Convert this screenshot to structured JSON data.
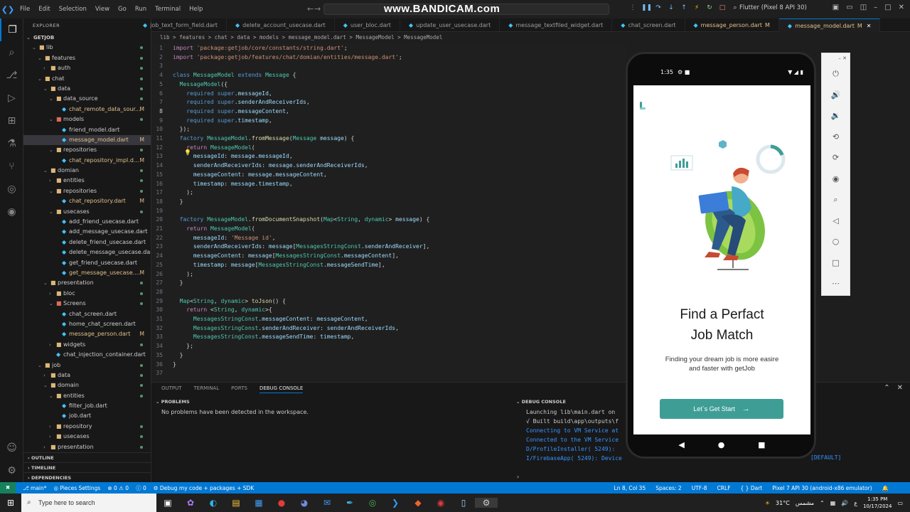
{
  "titlebar": {
    "menu": [
      "File",
      "Edit",
      "Selection",
      "View",
      "Go",
      "Run",
      "Terminal",
      "Help"
    ],
    "watermark": "www.BANDICAM.com",
    "device": "Flutter (Pixel 8 API 30)"
  },
  "sidebar": {
    "header": "EXPLORER",
    "root": "GETJOB",
    "tree": [
      {
        "label": "lib",
        "depth": 1,
        "kind": "folder",
        "open": true
      },
      {
        "label": "features",
        "depth": 2,
        "kind": "folder",
        "open": true
      },
      {
        "label": "auth",
        "depth": 3,
        "kind": "folder",
        "open": false
      },
      {
        "label": "chat",
        "depth": 2,
        "kind": "folder",
        "open": true
      },
      {
        "label": "data",
        "depth": 3,
        "kind": "folder",
        "open": true
      },
      {
        "label": "data_source",
        "depth": 4,
        "kind": "folder",
        "open": true
      },
      {
        "label": "chat_remote_data_sour...",
        "depth": 5,
        "kind": "dart",
        "mod": "M"
      },
      {
        "label": "models",
        "depth": 4,
        "kind": "folder-red",
        "open": true
      },
      {
        "label": "friend_model.dart",
        "depth": 5,
        "kind": "dart"
      },
      {
        "label": "message_model.dart",
        "depth": 5,
        "kind": "dart",
        "mod": "M",
        "selected": true
      },
      {
        "label": "repositories",
        "depth": 4,
        "kind": "folder",
        "open": true
      },
      {
        "label": "chat_repository_impl.d...",
        "depth": 5,
        "kind": "dart",
        "mod": "M"
      },
      {
        "label": "domian",
        "depth": 3,
        "kind": "folder",
        "open": true
      },
      {
        "label": "entities",
        "depth": 4,
        "kind": "folder",
        "open": false
      },
      {
        "label": "repositories",
        "depth": 4,
        "kind": "folder",
        "open": true
      },
      {
        "label": "chat_repository.dart",
        "depth": 5,
        "kind": "dart",
        "mod": "M"
      },
      {
        "label": "usecases",
        "depth": 4,
        "kind": "folder",
        "open": true
      },
      {
        "label": "add_friend_usecase.dart",
        "depth": 5,
        "kind": "dart"
      },
      {
        "label": "add_message_usecase.dart",
        "depth": 5,
        "kind": "dart"
      },
      {
        "label": "delete_friend_usecase.dart",
        "depth": 5,
        "kind": "dart"
      },
      {
        "label": "delete_message_usecase.dart",
        "depth": 5,
        "kind": "dart"
      },
      {
        "label": "get_friend_usecase.dart",
        "depth": 5,
        "kind": "dart"
      },
      {
        "label": "get_message_usecase....",
        "depth": 5,
        "kind": "dart",
        "mod": "M"
      },
      {
        "label": "presentation",
        "depth": 3,
        "kind": "folder",
        "open": true
      },
      {
        "label": "bloc",
        "depth": 4,
        "kind": "folder",
        "open": false
      },
      {
        "label": "Screens",
        "depth": 4,
        "kind": "folder-red",
        "open": true
      },
      {
        "label": "chat_screen.dart",
        "depth": 5,
        "kind": "dart"
      },
      {
        "label": "home_chat_screen.dart",
        "depth": 5,
        "kind": "dart"
      },
      {
        "label": "message_person.dart",
        "depth": 5,
        "kind": "dart",
        "mod": "M"
      },
      {
        "label": "widgets",
        "depth": 4,
        "kind": "folder",
        "open": false
      },
      {
        "label": "chat_injection_container.dart",
        "depth": 4,
        "kind": "dart"
      },
      {
        "label": "job",
        "depth": 2,
        "kind": "folder",
        "open": true
      },
      {
        "label": "data",
        "depth": 3,
        "kind": "folder",
        "open": false
      },
      {
        "label": "domain",
        "depth": 3,
        "kind": "folder",
        "open": true
      },
      {
        "label": "entities",
        "depth": 4,
        "kind": "folder",
        "open": true
      },
      {
        "label": "filter_job.dart",
        "depth": 5,
        "kind": "dart"
      },
      {
        "label": "job.dart",
        "depth": 5,
        "kind": "dart"
      },
      {
        "label": "repository",
        "depth": 4,
        "kind": "folder",
        "open": false
      },
      {
        "label": "usecases",
        "depth": 4,
        "kind": "folder",
        "open": false
      },
      {
        "label": "presentation",
        "depth": 3,
        "kind": "folder",
        "open": false
      }
    ],
    "outline": "OUTLINE",
    "timeline": "TIMELINE",
    "dependencies": "DEPENDENCIES"
  },
  "tabs": [
    {
      "label": "job_text_form_field.dart",
      "mod": ""
    },
    {
      "label": "delete_account_usecase.dart",
      "mod": ""
    },
    {
      "label": "user_bloc.dart",
      "mod": ""
    },
    {
      "label": "update_user_usecase.dart",
      "mod": ""
    },
    {
      "label": "message_textfiled_widget.dart",
      "mod": ""
    },
    {
      "label": "chat_screen.dart",
      "mod": ""
    },
    {
      "label": "message_person.dart",
      "mod": "M"
    },
    {
      "label": "message_model.dart",
      "mod": "M",
      "active": true
    }
  ],
  "breadcrumb": "lib > features > chat > data > models > message_model.dart > MessageModel > MessageModel",
  "code": [
    "import 'package:getjob/core/constants/string.dart';",
    "import 'package:getjob/features/chat/domian/entities/message.dart';",
    "",
    "class MessageModel extends Message {",
    "  MessageModel({",
    "    required super.messageId,",
    "    required super.senderAndReceiverIds,",
    "    required super.messageContent,",
    "    required super.timestamp,",
    "  });",
    "  factory MessageModel.fromMessage(Message message) {",
    "    return MessageModel(",
    "      messageId: message.messageId,",
    "      senderAndReceiverIds: message.senderAndReceiverIds,",
    "      messageContent: message.messageContent,",
    "      timestamp: message.timestamp,",
    "    );",
    "  }",
    "",
    "  factory MessageModel.fromDocumentSnapshot(Map<String, dynamic> message) {",
    "    return MessageModel(",
    "      messageId: 'Message id',",
    "      senderAndReceiverIds: message[MessagesStringConst.senderAndReceiver],",
    "      messageContent: message[MessagesStringConst.messageContent],",
    "      timestamp: message[MessagesStringConst.messageSendTime],",
    "    );",
    "  }",
    "",
    "  Map<String, dynamic> toJson() {",
    "    return <String, dynamic>{",
    "      MessagesStringConst.messageContent: messageContent,",
    "      MessagesStringConst.senderAndReceiver: senderAndReceiverIds,",
    "      MessagesStringConst.messageSendTime: timestamp,",
    "    };",
    "  }",
    "}",
    ""
  ],
  "panel": {
    "tabs": [
      "OUTPUT",
      "TERMINAL",
      "PORTS",
      "DEBUG CONSOLE"
    ],
    "problems_header": "PROBLEMS",
    "problems_message": "No problems have been detected in the workspace.",
    "debug_header": "DEBUG CONSOLE",
    "debug_lines": [
      "Launching lib\\main.dart on",
      "√ Built build\\app\\outputs\\f",
      "Connecting to VM Service at",
      "Connected to the VM Service",
      "D/ProfileInstaller( 5249):",
      "I/FirebaseApp( 5249): Device u"
    ],
    "debug_default": "[DEFAULT]"
  },
  "phone": {
    "time": "1:35",
    "headline_line1": "Find a Perfact",
    "headline_line2": "Job Match",
    "sub_line1": "Finding your dream job is more easire",
    "sub_line2": "and faster with getJob",
    "cta": "Let`s Get Start",
    "colors": {
      "accent": "#3e9e96"
    }
  },
  "statusbar": {
    "branch": "main*",
    "pieces": "Pieces Settings",
    "errors": "0",
    "warnings": "0",
    "info": "0",
    "debug": "Debug my code + packages + SDK",
    "position": "Ln 8, Col 35",
    "spaces": "Spaces: 2",
    "encoding": "UTF-8",
    "eol": "CRLF",
    "lang": "Dart",
    "device": "Pixel 7 API 30 (android-x86 emulator)"
  },
  "taskbar": {
    "search_placeholder": "Type here to search",
    "weather": "31°C",
    "weather_desc": "مشمس",
    "lang": "ع",
    "time": "1:35 PM",
    "date": "10/17/2024"
  }
}
